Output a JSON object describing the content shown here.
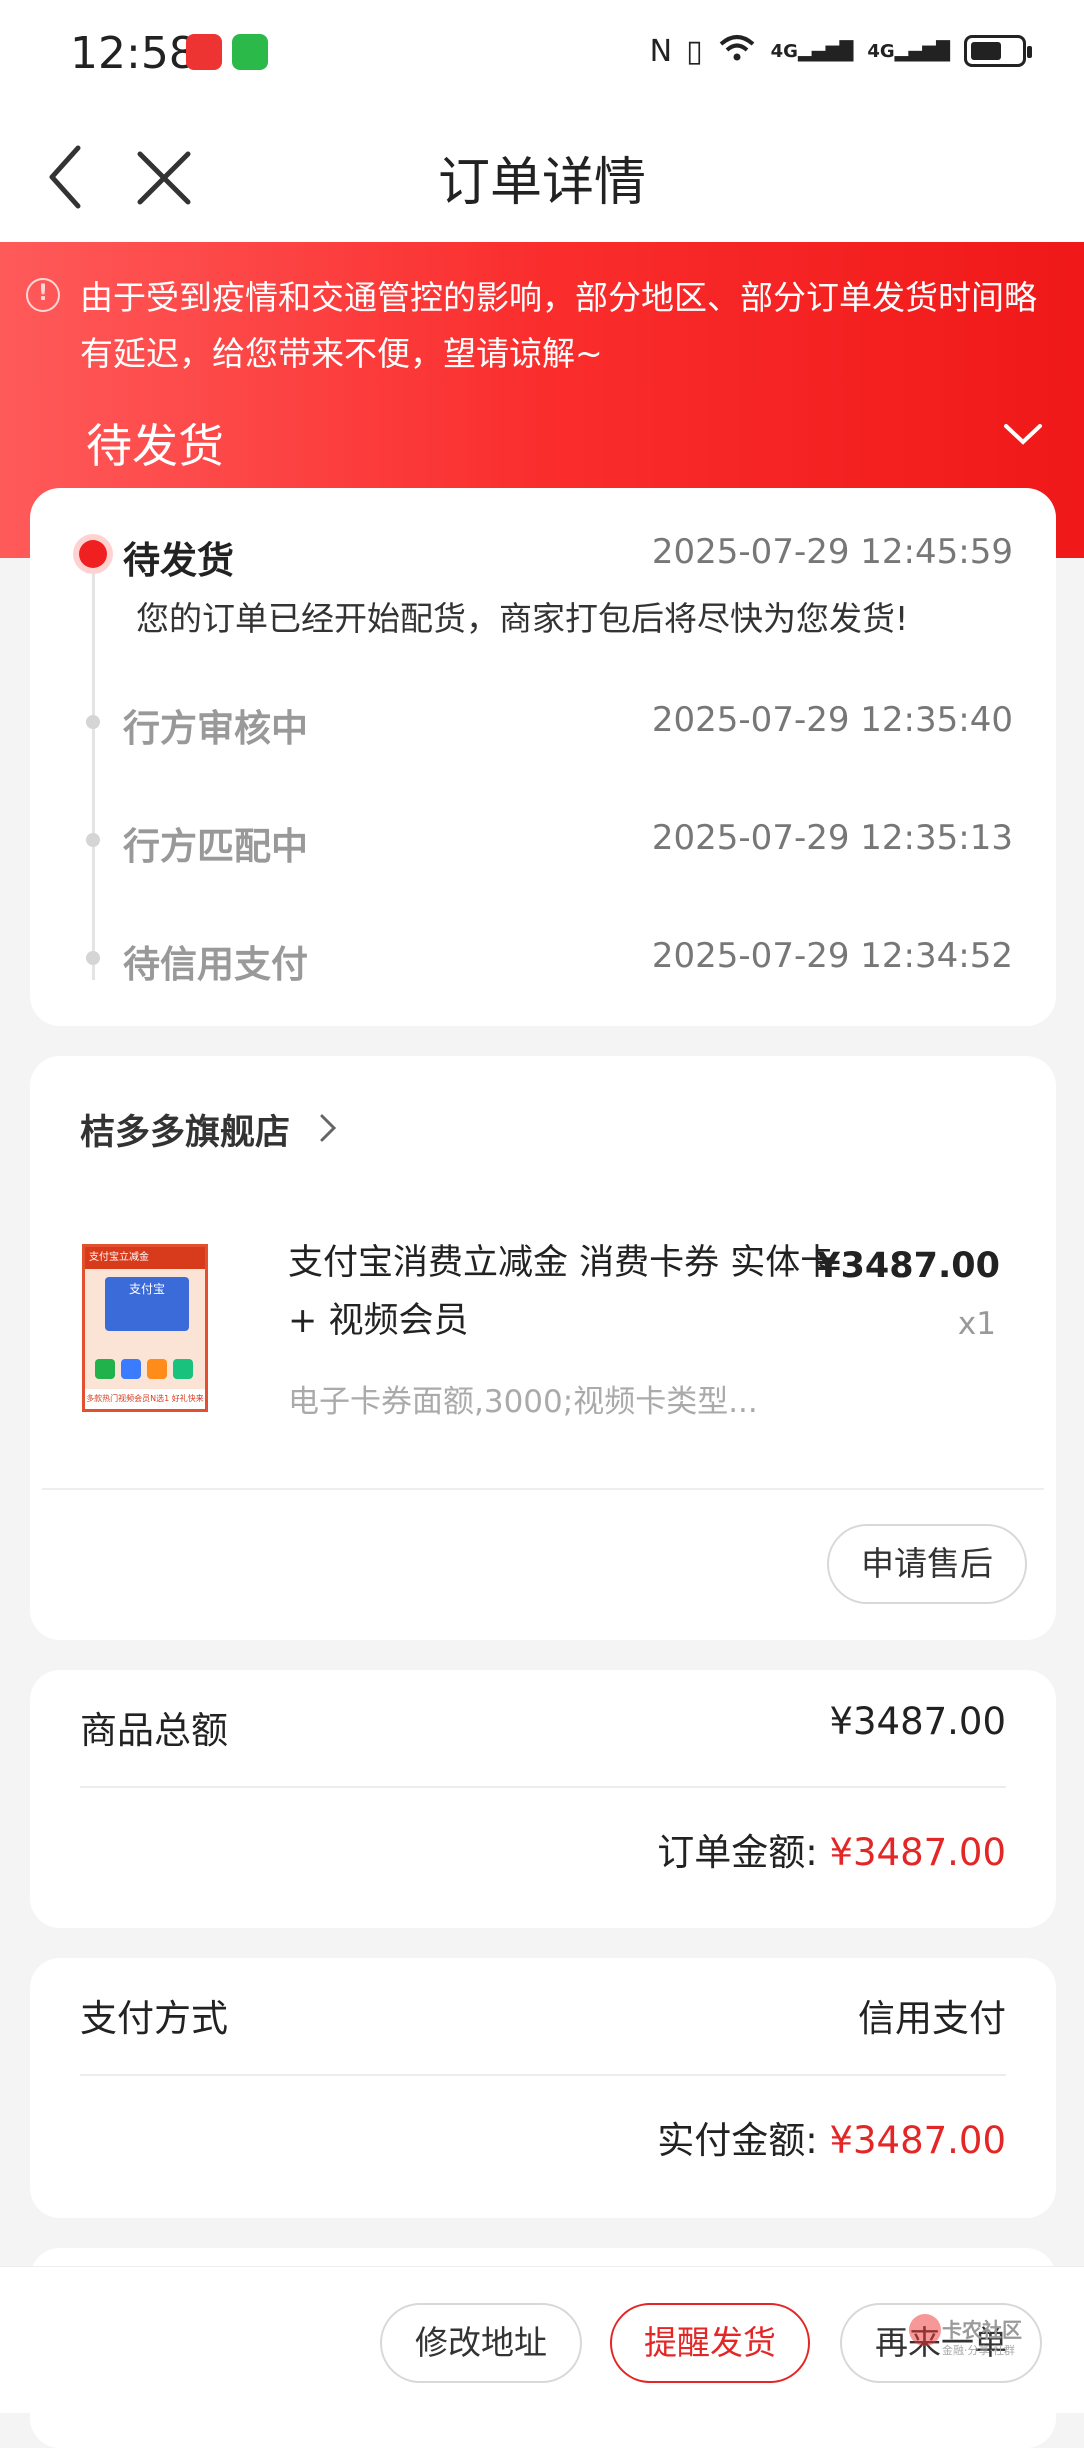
{
  "status_bar": {
    "time": "12:58",
    "network_a": "4G",
    "network_b": "4G",
    "wifi_badge": "6"
  },
  "nav": {
    "title": "订单详情"
  },
  "notice": {
    "icon": "!",
    "text": "由于受到疫情和交通管控的影响，部分地区、部分订单发货时间略有延迟，给您带来不便，望请谅解~"
  },
  "hero": {
    "status": "待发货"
  },
  "timeline": [
    {
      "label": "待发货",
      "time": "2025-07-29 12:45:59",
      "desc": "您的订单已经开始配货，商家打包后将尽快为您发货!"
    },
    {
      "label": "行方审核中",
      "time": "2025-07-29 12:35:40"
    },
    {
      "label": "行方匹配中",
      "time": "2025-07-29 12:35:13"
    },
    {
      "label": "待信用支付",
      "time": "2025-07-29 12:34:52"
    }
  ],
  "shop": {
    "name": "桔多多旗舰店",
    "product": {
      "title": "支付宝消费立减金 消费卡券 实体卡 + 视频会员",
      "price": "¥3487.00",
      "qty": "x1",
      "spec": "电子卡券面额,3000;视频卡类型...",
      "image": {
        "banner": "支付宝立减金",
        "card": "支付宝",
        "footer": "多款热门视频会员N选1 好礼快来拿"
      }
    },
    "after_sale_label": "申请售后"
  },
  "amounts": {
    "goods_total_label": "商品总额",
    "goods_total": "¥3487.00",
    "order_amount_label": "订单金额:",
    "order_amount": "¥3487.00"
  },
  "payment": {
    "method_label": "支付方式",
    "method": "信用支付",
    "paid_label": "实付金额:",
    "paid": "¥3487.00"
  },
  "bottom_buttons": {
    "modify_address": "修改地址",
    "remind_ship": "提醒发货",
    "buy_again": "再来一单"
  },
  "watermark": {
    "text": "卡农社区",
    "sub": "金融·分享·社群"
  },
  "colors": {
    "accent": "#e32626",
    "hero_start": "#ff5a5a",
    "hero_end": "#f01818"
  }
}
